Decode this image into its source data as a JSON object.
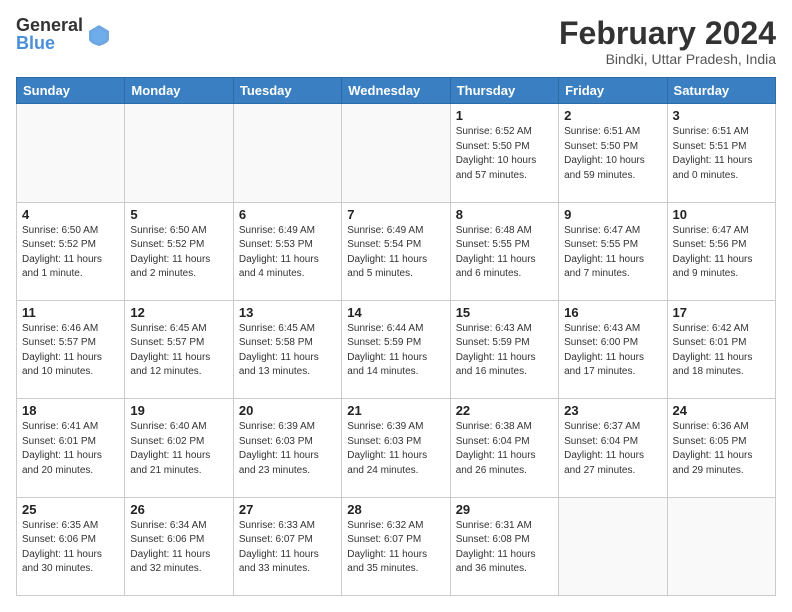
{
  "header": {
    "logo_general": "General",
    "logo_blue": "Blue",
    "month_title": "February 2024",
    "subtitle": "Bindki, Uttar Pradesh, India"
  },
  "days_of_week": [
    "Sunday",
    "Monday",
    "Tuesday",
    "Wednesday",
    "Thursday",
    "Friday",
    "Saturday"
  ],
  "weeks": [
    [
      {
        "day": "",
        "info": ""
      },
      {
        "day": "",
        "info": ""
      },
      {
        "day": "",
        "info": ""
      },
      {
        "day": "",
        "info": ""
      },
      {
        "day": "1",
        "info": "Sunrise: 6:52 AM\nSunset: 5:50 PM\nDaylight: 10 hours and 57 minutes."
      },
      {
        "day": "2",
        "info": "Sunrise: 6:51 AM\nSunset: 5:50 PM\nDaylight: 10 hours and 59 minutes."
      },
      {
        "day": "3",
        "info": "Sunrise: 6:51 AM\nSunset: 5:51 PM\nDaylight: 11 hours and 0 minutes."
      }
    ],
    [
      {
        "day": "4",
        "info": "Sunrise: 6:50 AM\nSunset: 5:52 PM\nDaylight: 11 hours and 1 minute."
      },
      {
        "day": "5",
        "info": "Sunrise: 6:50 AM\nSunset: 5:52 PM\nDaylight: 11 hours and 2 minutes."
      },
      {
        "day": "6",
        "info": "Sunrise: 6:49 AM\nSunset: 5:53 PM\nDaylight: 11 hours and 4 minutes."
      },
      {
        "day": "7",
        "info": "Sunrise: 6:49 AM\nSunset: 5:54 PM\nDaylight: 11 hours and 5 minutes."
      },
      {
        "day": "8",
        "info": "Sunrise: 6:48 AM\nSunset: 5:55 PM\nDaylight: 11 hours and 6 minutes."
      },
      {
        "day": "9",
        "info": "Sunrise: 6:47 AM\nSunset: 5:55 PM\nDaylight: 11 hours and 7 minutes."
      },
      {
        "day": "10",
        "info": "Sunrise: 6:47 AM\nSunset: 5:56 PM\nDaylight: 11 hours and 9 minutes."
      }
    ],
    [
      {
        "day": "11",
        "info": "Sunrise: 6:46 AM\nSunset: 5:57 PM\nDaylight: 11 hours and 10 minutes."
      },
      {
        "day": "12",
        "info": "Sunrise: 6:45 AM\nSunset: 5:57 PM\nDaylight: 11 hours and 12 minutes."
      },
      {
        "day": "13",
        "info": "Sunrise: 6:45 AM\nSunset: 5:58 PM\nDaylight: 11 hours and 13 minutes."
      },
      {
        "day": "14",
        "info": "Sunrise: 6:44 AM\nSunset: 5:59 PM\nDaylight: 11 hours and 14 minutes."
      },
      {
        "day": "15",
        "info": "Sunrise: 6:43 AM\nSunset: 5:59 PM\nDaylight: 11 hours and 16 minutes."
      },
      {
        "day": "16",
        "info": "Sunrise: 6:43 AM\nSunset: 6:00 PM\nDaylight: 11 hours and 17 minutes."
      },
      {
        "day": "17",
        "info": "Sunrise: 6:42 AM\nSunset: 6:01 PM\nDaylight: 11 hours and 18 minutes."
      }
    ],
    [
      {
        "day": "18",
        "info": "Sunrise: 6:41 AM\nSunset: 6:01 PM\nDaylight: 11 hours and 20 minutes."
      },
      {
        "day": "19",
        "info": "Sunrise: 6:40 AM\nSunset: 6:02 PM\nDaylight: 11 hours and 21 minutes."
      },
      {
        "day": "20",
        "info": "Sunrise: 6:39 AM\nSunset: 6:03 PM\nDaylight: 11 hours and 23 minutes."
      },
      {
        "day": "21",
        "info": "Sunrise: 6:39 AM\nSunset: 6:03 PM\nDaylight: 11 hours and 24 minutes."
      },
      {
        "day": "22",
        "info": "Sunrise: 6:38 AM\nSunset: 6:04 PM\nDaylight: 11 hours and 26 minutes."
      },
      {
        "day": "23",
        "info": "Sunrise: 6:37 AM\nSunset: 6:04 PM\nDaylight: 11 hours and 27 minutes."
      },
      {
        "day": "24",
        "info": "Sunrise: 6:36 AM\nSunset: 6:05 PM\nDaylight: 11 hours and 29 minutes."
      }
    ],
    [
      {
        "day": "25",
        "info": "Sunrise: 6:35 AM\nSunset: 6:06 PM\nDaylight: 11 hours and 30 minutes."
      },
      {
        "day": "26",
        "info": "Sunrise: 6:34 AM\nSunset: 6:06 PM\nDaylight: 11 hours and 32 minutes."
      },
      {
        "day": "27",
        "info": "Sunrise: 6:33 AM\nSunset: 6:07 PM\nDaylight: 11 hours and 33 minutes."
      },
      {
        "day": "28",
        "info": "Sunrise: 6:32 AM\nSunset: 6:07 PM\nDaylight: 11 hours and 35 minutes."
      },
      {
        "day": "29",
        "info": "Sunrise: 6:31 AM\nSunset: 6:08 PM\nDaylight: 11 hours and 36 minutes."
      },
      {
        "day": "",
        "info": ""
      },
      {
        "day": "",
        "info": ""
      }
    ]
  ]
}
